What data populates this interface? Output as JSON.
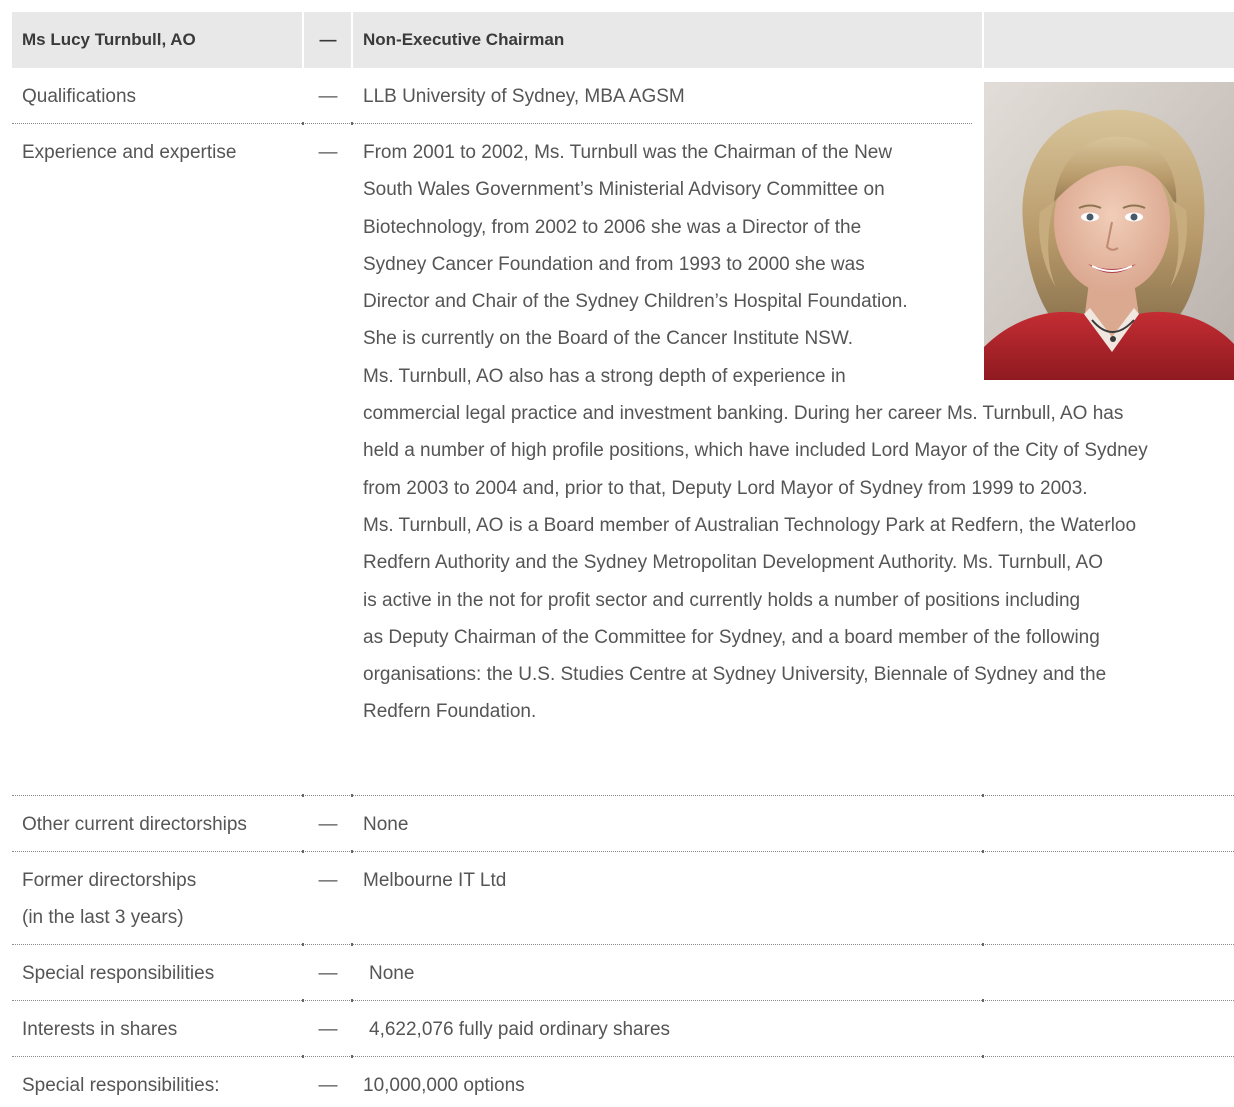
{
  "header": {
    "name": "Ms Lucy Turnbull, AO",
    "dash": "—",
    "role": "Non-Executive Chairman"
  },
  "rows": [
    {
      "label": "Qualifications",
      "dash": "—",
      "value": "LLB University of Sydney, MBA AGSM"
    },
    {
      "label": "Experience and expertise",
      "dash": "—",
      "value": "From 2001 to 2002, Ms. Turnbull was the Chairman of the New South Wales Government’s Ministerial Advisory Committee on Biotechnology, from 2002 to 2006 she was a Director of the Sydney Cancer Foundation and from 1993 to 2000 she was Director and Chair of the Sydney Children’s Hospital Foundation. She is currently on the Board of the Cancer Institute NSW. Ms. Turnbull, AO also has a strong depth of experience in commercial legal practice and investment banking. During her career Ms. Turnbull, AO has held a number of high profile positions, which have included Lord Mayor of the City of Sydney from 2003 to 2004 and, prior to that, Deputy Lord Mayor of Sydney from 1999 to 2003. Ms. Turnbull, AO is a Board member of Australian Technology Park at Redfern, the Waterloo Redfern Authority and the Sydney Metropolitan Development Authority. Ms. Turnbull, AO is active in the not for profit sector and currently holds a number of positions including as Deputy Chairman of the Committee for Sydney, and a board member of the following organisations: the U.S. Studies Centre at Sydney University, Biennale of Sydney and the Redfern Foundation.",
      "lines": [
        "From 2001 to 2002, Ms. Turnbull was the Chairman of the New",
        "South Wales Government’s Ministerial Advisory Committee on",
        "Biotechnology, from 2002 to 2006 she was a Director of the",
        "Sydney Cancer Foundation and from 1993 to 2000 she was",
        "Director and Chair of the Sydney Children’s Hospital Foundation.",
        "She is currently on the Board of the Cancer Institute NSW.",
        "Ms. Turnbull, AO also has a strong depth of experience in",
        "commercial legal practice and investment banking. During her career Ms. Turnbull, AO has",
        "held a number of high profile positions, which have included Lord Mayor of the City of Sydney",
        "from 2003 to 2004 and, prior to that, Deputy Lord Mayor of Sydney from 1999 to 2003.",
        "Ms. Turnbull, AO is a Board member of Australian Technology Park at Redfern, the Waterloo",
        "Redfern Authority and the Sydney Metropolitan Development Authority. Ms. Turnbull, AO",
        "is active in the not for profit sector and currently holds a number of positions including",
        "as Deputy Chairman of the Committee for Sydney, and a board member of the following",
        "organisations: the U.S. Studies Centre at Sydney University, Biennale of Sydney and the",
        "Redfern Foundation."
      ]
    },
    {
      "label": "Other current directorships",
      "dash": "—",
      "value": "None"
    },
    {
      "label": "Former directorships",
      "label2": "(in the last 3 years)",
      "dash": "—",
      "value": "Melbourne IT Ltd"
    },
    {
      "label": "Special responsibilities",
      "dash": "—",
      "value": "None"
    },
    {
      "label": "Interests in shares",
      "dash": "—",
      "value": "4,622,076 fully paid ordinary shares"
    },
    {
      "label": "Special responsibilities:",
      "dash": "—",
      "value": "10,000,000 options"
    }
  ],
  "photo": {
    "subject": "portrait-photo"
  },
  "colors": {
    "header_bg": "#e8e8e8",
    "text": "#555555",
    "header_text": "#3a3a3a",
    "jacket": "#b8232a"
  }
}
